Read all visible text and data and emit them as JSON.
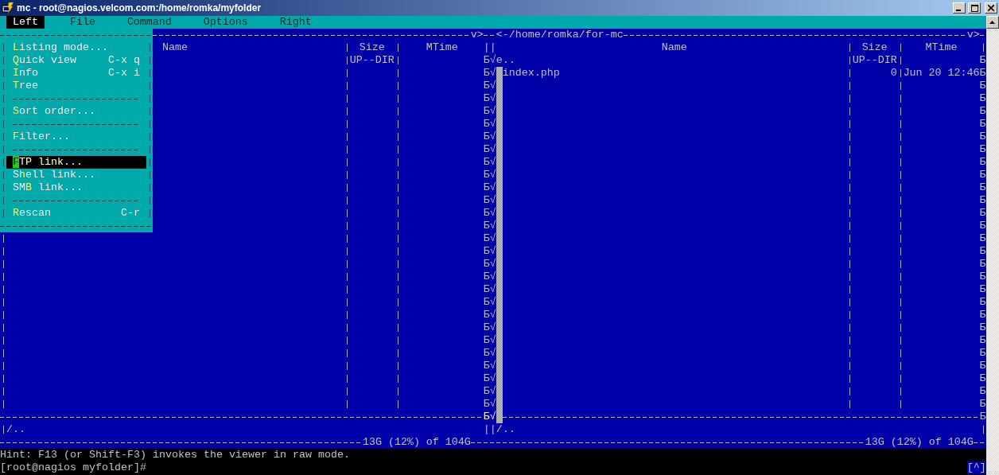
{
  "window": {
    "title": "mc - root@nagios.velcom.com:/home/romka/myfolder"
  },
  "menu_bar": [
    {
      "label": "Left",
      "selected": true
    },
    {
      "label": "File",
      "selected": false
    },
    {
      "label": "Command",
      "selected": false
    },
    {
      "label": "Options",
      "selected": false
    },
    {
      "label": "Right",
      "selected": false
    }
  ],
  "dropdown": {
    "items": [
      {
        "kind": "item",
        "key": "L",
        "post": "isting mode...",
        "selected": false
      },
      {
        "kind": "item",
        "key": "Q",
        "post": "uick view",
        "shortcut": "C-x q",
        "selected": false
      },
      {
        "kind": "item",
        "key": "I",
        "post": "nfo",
        "shortcut": "C-x i",
        "selected": false
      },
      {
        "kind": "item",
        "key": "T",
        "post": "ree",
        "selected": false
      },
      {
        "kind": "separator"
      },
      {
        "kind": "item",
        "key": "S",
        "post": "ort order...",
        "selected": false
      },
      {
        "kind": "separator"
      },
      {
        "kind": "item",
        "key": "F",
        "post": "ilter...",
        "selected": false
      },
      {
        "kind": "separator"
      },
      {
        "kind": "item",
        "key": "F",
        "post": "TP link...",
        "selected": true
      },
      {
        "kind": "item",
        "pre": "S",
        "key": "h",
        "post": "ell link...",
        "selected": false
      },
      {
        "kind": "item",
        "pre": "SM",
        "key": "B",
        "post": " link...",
        "selected": false
      },
      {
        "kind": "separator"
      },
      {
        "kind": "item",
        "key": "R",
        "post": "escan",
        "shortcut": "C-r",
        "selected": false
      }
    ]
  },
  "left_panel": {
    "top_marker": "v>",
    "columns": [
      "Name",
      "Size",
      "MTime"
    ],
    "rows": [
      {
        "size": "UP--DIR"
      }
    ],
    "status": "/..",
    "free_space": "13G (12%) of 104G"
  },
  "junction": {
    "header": "||",
    "separator": "Б√",
    "status": "||"
  },
  "right_panel": {
    "path": "<-/home/romka/for-mc",
    "top_marker": "v>",
    "columns": [
      "Name",
      "Size",
      "MTime"
    ],
    "rows": [
      {
        "glyph": "Б√",
        "marked": false,
        "name": "е..",
        "size": "UP--DIR",
        "end": "Б"
      },
      {
        "glyph": "Б√",
        "marked": true,
        "name": "index.php",
        "size": "0",
        "mtime": "Jun 20 12:46",
        "end": "Б"
      },
      {
        "glyph": "Б√",
        "marked": true,
        "end": "Б"
      },
      {
        "glyph": "Б√",
        "marked": true,
        "end": "Б"
      },
      {
        "glyph": "Б√",
        "marked": true,
        "end": "Б"
      },
      {
        "glyph": "Б√",
        "marked": true,
        "end": "Б"
      },
      {
        "glyph": "Б√",
        "marked": true,
        "end": "Б"
      },
      {
        "glyph": "Б√",
        "marked": true,
        "end": "Б"
      },
      {
        "glyph": "Б√",
        "marked": true,
        "end": "Б"
      },
      {
        "glyph": "Б√",
        "marked": true,
        "end": "Б"
      },
      {
        "glyph": "Б√",
        "marked": true,
        "end": "Б"
      },
      {
        "glyph": "Б√",
        "marked": true,
        "end": "Б"
      },
      {
        "glyph": "Б√",
        "marked": true,
        "end": "Б"
      },
      {
        "glyph": "Б√",
        "marked": true,
        "end": "Б"
      },
      {
        "glyph": "Б√",
        "marked": true,
        "end": "Б"
      },
      {
        "glyph": "Б√",
        "marked": true,
        "end": "Б"
      },
      {
        "glyph": "Б√",
        "marked": true,
        "end": "Б"
      },
      {
        "glyph": "Б√",
        "marked": true,
        "end": "Б"
      },
      {
        "glyph": "Б√",
        "marked": true,
        "end": "Б"
      },
      {
        "glyph": "Б√",
        "marked": true,
        "end": "Б"
      },
      {
        "glyph": "Б√",
        "marked": true,
        "end": "Б"
      },
      {
        "glyph": "Б√",
        "marked": true,
        "end": "Б"
      },
      {
        "glyph": "Б√",
        "marked": true,
        "end": "Б"
      },
      {
        "glyph": "Б√",
        "marked": true,
        "end": "Б"
      },
      {
        "glyph": "Б√",
        "marked": true,
        "end": "Б"
      },
      {
        "glyph": "Б√",
        "marked": true,
        "end": "Б"
      },
      {
        "glyph": "Б√",
        "marked": true,
        "end": "Б"
      },
      {
        "glyph": "Б√",
        "marked": true,
        "end": "Б"
      }
    ],
    "separator_end": "Б",
    "status": "/..",
    "free_space": "13G (12%) of 104G"
  },
  "hint": "Hint: F13 (or Shift-F3) invokes the viewer in raw mode.",
  "prompt": "[root@nagios myfolder]#",
  "indicator": "[^]"
}
